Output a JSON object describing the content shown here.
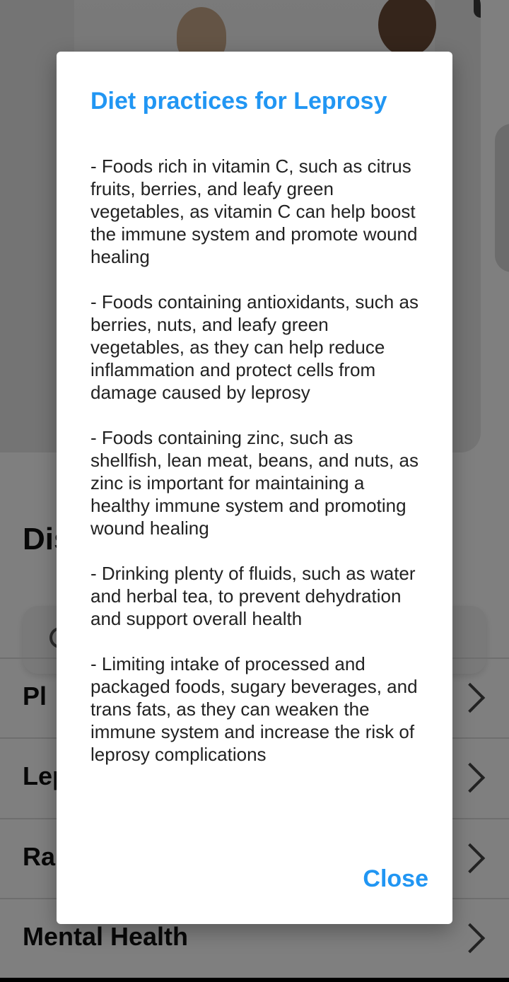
{
  "background": {
    "section_title": "Diseases",
    "list_items": [
      {
        "label": "Pl"
      },
      {
        "label": "Leprosy"
      },
      {
        "label": "Rabies"
      },
      {
        "label": "Mental Health"
      }
    ]
  },
  "dialog": {
    "title": "Diet practices for Leprosy",
    "paragraphs": [
      "- Foods rich in vitamin C, such as citrus fruits, berries, and leafy green vegetables, as vitamin C can help boost the immune system and promote wound healing",
      "- Foods containing antioxidants, such as berries, nuts, and leafy green vegetables, as they can help reduce inflammation and protect cells from damage caused by leprosy",
      "- Foods containing zinc, such as shellfish, lean meat, beans, and nuts, as zinc is important for maintaining a healthy immune system and promoting wound healing",
      "- Drinking plenty of fluids, such as water and herbal tea, to prevent dehydration and support overall health",
      "- Limiting intake of processed and packaged foods, sugary beverages, and trans fats, as they can weaken the immune system and increase the risk of leprosy complications"
    ],
    "close_label": "Close"
  },
  "colors": {
    "accent": "#2196f3",
    "scrim": "rgba(0,0,0,0.5)"
  }
}
